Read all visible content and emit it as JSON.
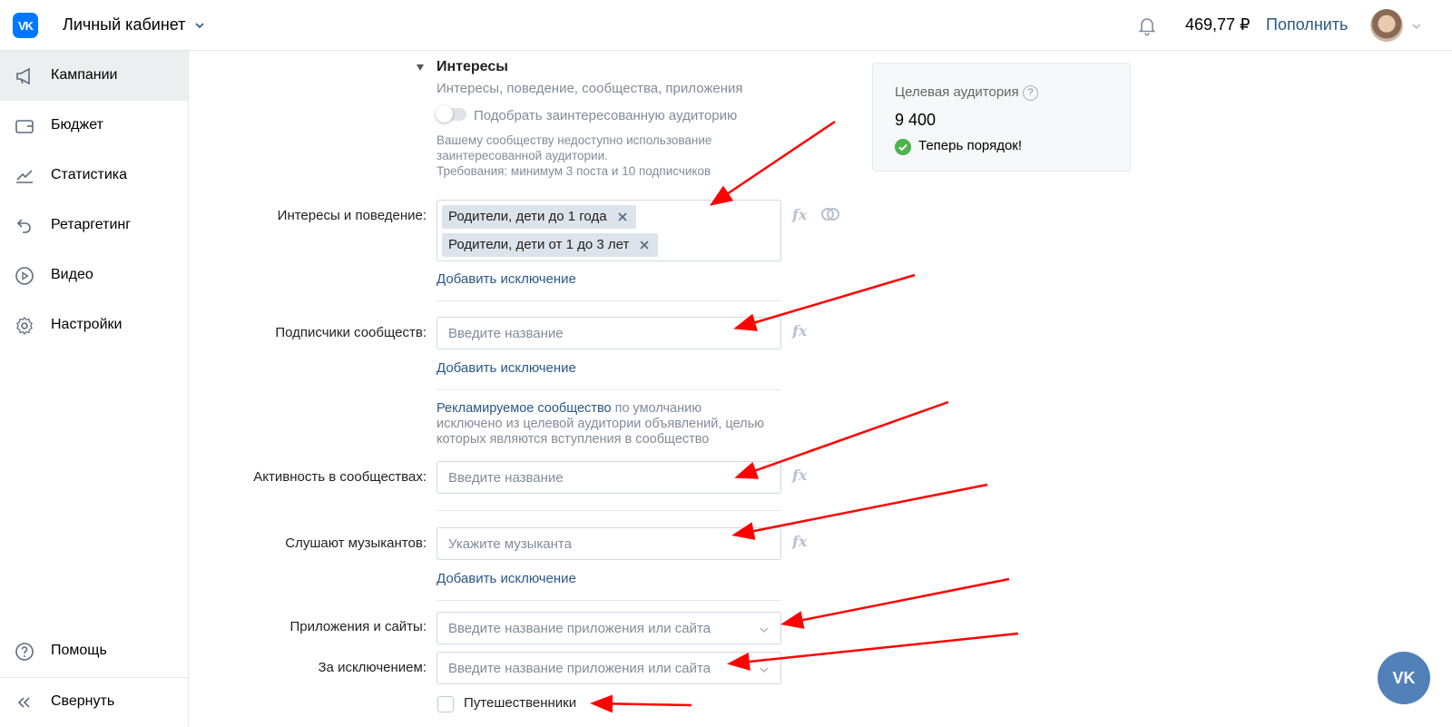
{
  "header": {
    "logo_text": "VK",
    "cabinet_title": "Личный кабинет",
    "balance": "469,77 ₽",
    "topup_label": "Пополнить"
  },
  "sidebar": {
    "items": [
      {
        "label": "Кампании",
        "icon": "megaphone-icon",
        "active": true
      },
      {
        "label": "Бюджет",
        "icon": "wallet-icon",
        "active": false
      },
      {
        "label": "Статистика",
        "icon": "chart-icon",
        "active": false
      },
      {
        "label": "Ретаргетинг",
        "icon": "retarget-icon",
        "active": false
      },
      {
        "label": "Видео",
        "icon": "play-icon",
        "active": false
      },
      {
        "label": "Настройки",
        "icon": "gear-icon",
        "active": false
      }
    ],
    "help_label": "Помощь",
    "collapse_label": "Свернуть"
  },
  "interests": {
    "section_title": "Интересы",
    "section_subtitle": "Интересы, поведение, сообщества, приложения",
    "toggle_label": "Подобрать заинтересованную аудиторию",
    "toggle_on": false,
    "note_lines": [
      "Вашему сообществу недоступно использование",
      "заинтересованной аудитории.",
      "Требования: минимум 3 поста и 10 подписчиков"
    ]
  },
  "fields": {
    "interests_behavior": {
      "label": "Интересы и поведение:",
      "tags": [
        "Родители, дети до 1 года",
        "Родители, дети от 1 до 3 лет"
      ],
      "add_exclusion": "Добавить исключение",
      "fx": "fx"
    },
    "community_subscribers": {
      "label": "Подписчики сообществ:",
      "placeholder": "Введите название",
      "add_exclusion": "Добавить исключение",
      "fx": "fx"
    },
    "community_note": {
      "line1_link": "Рекламируемое сообщество",
      "line1_rest": " по умолчанию",
      "line2": "исключено из целевой аудитории объявлений, целью",
      "line3": "которых являются вступления в сообщество"
    },
    "community_activity": {
      "label": "Активность в сообществах:",
      "placeholder": "Введите название",
      "fx": "fx"
    },
    "musicians": {
      "label": "Слушают музыкантов:",
      "placeholder": "Укажите музыканта",
      "add_exclusion": "Добавить исключение",
      "fx": "fx"
    },
    "apps_sites": {
      "label": "Приложения и сайты:",
      "placeholder": "Введите название приложения или сайта"
    },
    "except": {
      "label": "За исключением:",
      "placeholder": "Введите название приложения или сайта"
    },
    "travelers": {
      "label": "Путешественники",
      "checked": false
    }
  },
  "audience": {
    "title": "Целевая аудитория",
    "help": "?",
    "count": "9 400",
    "status": "Теперь порядок!"
  },
  "colors": {
    "accent": "#2a5885",
    "brand": "#0077ff",
    "annotation_arrow": "#ff0000",
    "success": "#4bb34b"
  },
  "fab_text": "VK"
}
